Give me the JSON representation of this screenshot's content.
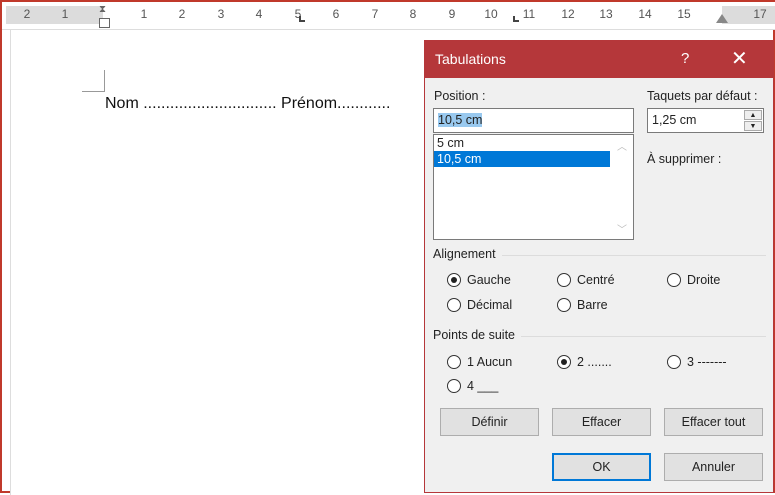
{
  "ruler": {
    "labels": [
      "2",
      "1",
      "1",
      "2",
      "3",
      "4",
      "5",
      "6",
      "7",
      "8",
      "9",
      "10",
      "11",
      "12",
      "13",
      "14",
      "15",
      "17"
    ]
  },
  "document": {
    "line": "Nom .............................. Prénom............"
  },
  "dialog": {
    "title": "Tabulations",
    "help": "?",
    "close": "✕",
    "position_label": "Position :",
    "position_value": "10,5 cm",
    "tab_list": [
      "5 cm",
      "10,5 cm"
    ],
    "default_label": "Taquets par défaut :",
    "default_value": "1,25 cm",
    "remove_label": "À supprimer :",
    "alignment_label": "Alignement",
    "alignment": [
      "Gauche",
      "Centré",
      "Droite",
      "Décimal",
      "Barre"
    ],
    "alignment_selected": "Gauche",
    "leader_label": "Points de suite",
    "leaders": [
      "1 Aucun",
      "2 .......",
      "3 -------",
      "4 ___"
    ],
    "leader_selected": "2 .......",
    "buttons": {
      "set": "Définir",
      "clear": "Effacer",
      "clear_all": "Effacer tout",
      "ok": "OK",
      "cancel": "Annuler"
    }
  }
}
